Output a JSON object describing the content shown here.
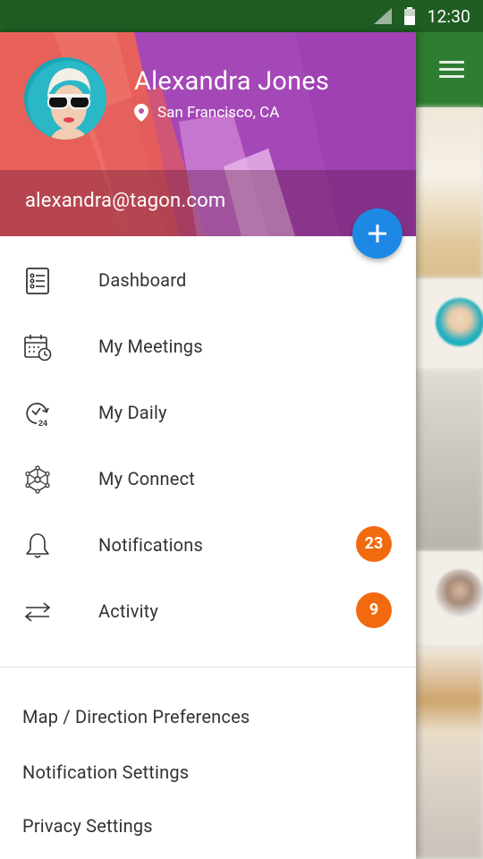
{
  "status_bar": {
    "time": "12:30"
  },
  "profile": {
    "name": "Alexandra Jones",
    "location": "San Francisco, CA",
    "email": "alexandra@tagon.com"
  },
  "fab": {
    "icon": "plus-icon"
  },
  "menu": {
    "items": [
      {
        "label": "Dashboard",
        "icon": "dashboard-list-icon"
      },
      {
        "label": "My Meetings",
        "icon": "calendar-clock-icon"
      },
      {
        "label": "My Daily",
        "icon": "clock-24-icon"
      },
      {
        "label": "My Connect",
        "icon": "network-icon"
      },
      {
        "label": "Notifications",
        "icon": "bell-icon",
        "badge": "23"
      },
      {
        "label": "Activity",
        "icon": "swap-arrows-icon",
        "badge": "9"
      }
    ]
  },
  "settings": {
    "items": [
      {
        "label": "Map / Direction Preferences"
      },
      {
        "label": "Notification Settings"
      },
      {
        "label": "Privacy Settings"
      }
    ]
  },
  "colors": {
    "status_bar": "#1f5d23",
    "app_bar": "#2e7d32",
    "fab": "#1e88e5",
    "badge": "#f26a0f",
    "header_purple": "#a548b7",
    "header_red": "#e8605a"
  }
}
